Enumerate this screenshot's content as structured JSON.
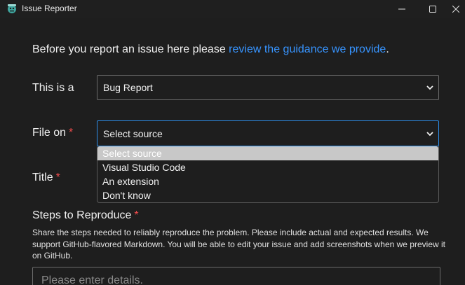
{
  "window": {
    "title": "Issue Reporter",
    "app_icon": "vscode-issue-reporter-icon",
    "controls": [
      "minimize-icon",
      "maximize-icon",
      "close-icon"
    ]
  },
  "intro": {
    "prefix": "Before you report an issue here please ",
    "link": "review the guidance we provide",
    "suffix": "."
  },
  "issue_type": {
    "label": "This is a",
    "value": "Bug Report"
  },
  "file_on": {
    "label": "File on",
    "required_mark": "*",
    "value": "Select source",
    "options": [
      "Select source",
      "Visual Studio Code",
      "An extension",
      "Don't know"
    ]
  },
  "title_field": {
    "label": "Title",
    "required_mark": "*"
  },
  "steps": {
    "label": "Steps to Reproduce",
    "required_mark": "*",
    "description": "Share the steps needed to reliably reproduce the problem. Please include actual and expected results. We support GitHub-flavored Markdown. You will be able to edit your issue and add screenshots when we preview it on GitHub.",
    "placeholder": "Please enter details."
  },
  "colors": {
    "background": "#1e1e1e",
    "link": "#3794ff",
    "required": "#f14c4c",
    "focus_border": "#2e8ee8",
    "highlight": "#c8c8c8"
  }
}
